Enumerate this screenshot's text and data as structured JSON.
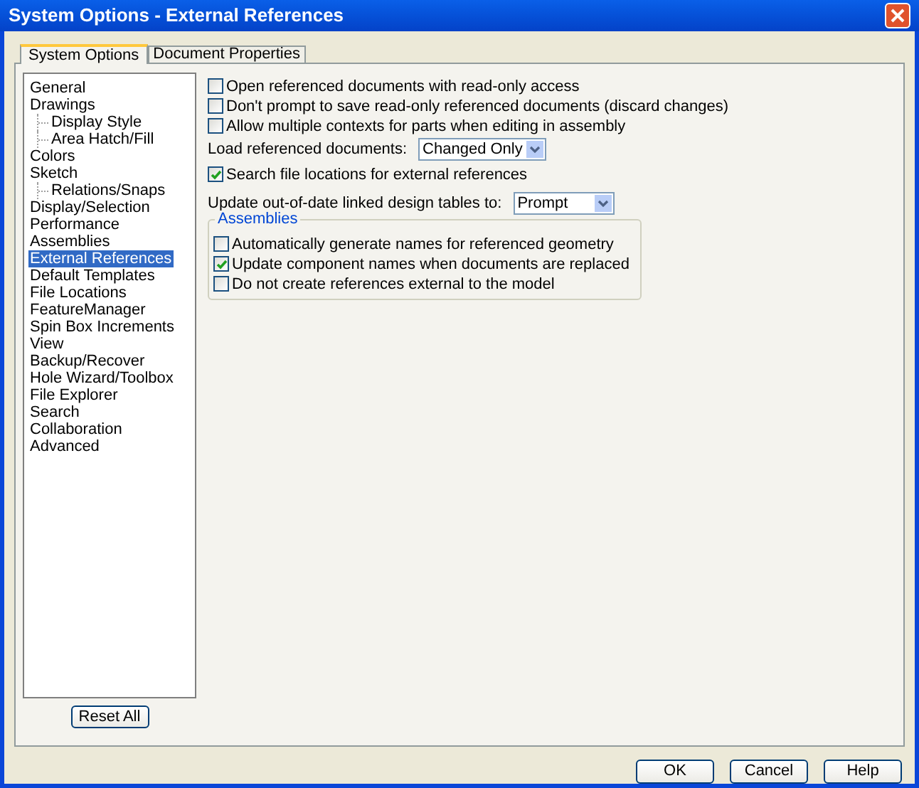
{
  "window": {
    "title": "System Options - External References"
  },
  "tabs": [
    {
      "label": "System Options",
      "selected": true
    },
    {
      "label": "Document Properties",
      "selected": false
    }
  ],
  "tree": [
    {
      "label": "General",
      "selected": false
    },
    {
      "label": "Drawings",
      "selected": false,
      "children": [
        {
          "label": "Display Style",
          "selected": false
        },
        {
          "label": "Area Hatch/Fill",
          "selected": false
        }
      ]
    },
    {
      "label": "Colors",
      "selected": false
    },
    {
      "label": "Sketch",
      "selected": false,
      "children": [
        {
          "label": "Relations/Snaps",
          "selected": false
        }
      ]
    },
    {
      "label": "Display/Selection",
      "selected": false
    },
    {
      "label": "Performance",
      "selected": false
    },
    {
      "label": "Assemblies",
      "selected": false
    },
    {
      "label": "External References",
      "selected": true
    },
    {
      "label": "Default Templates",
      "selected": false
    },
    {
      "label": "File Locations",
      "selected": false
    },
    {
      "label": "FeatureManager",
      "selected": false
    },
    {
      "label": "Spin Box Increments",
      "selected": false
    },
    {
      "label": "View",
      "selected": false
    },
    {
      "label": "Backup/Recover",
      "selected": false
    },
    {
      "label": "Hole Wizard/Toolbox",
      "selected": false
    },
    {
      "label": "File Explorer",
      "selected": false
    },
    {
      "label": "Search",
      "selected": false
    },
    {
      "label": "Collaboration",
      "selected": false
    },
    {
      "label": "Advanced",
      "selected": false
    }
  ],
  "reset_button": "Reset All",
  "options": [
    {
      "kind": "checkbox",
      "label": "Open referenced documents with read-only access",
      "checked": false
    },
    {
      "kind": "checkbox",
      "label": "Don't prompt to save read-only referenced documents (discard changes)",
      "checked": false
    },
    {
      "kind": "checkbox",
      "label": "Allow multiple contexts for parts when editing in assembly",
      "checked": false
    },
    {
      "kind": "dropdown",
      "label": "Load referenced documents:",
      "value": "Changed Only"
    },
    {
      "kind": "checkbox",
      "label": "Search file locations for external references",
      "checked": true
    },
    {
      "kind": "dropdown",
      "label": "Update out-of-date linked design tables to:",
      "value": "Prompt"
    }
  ],
  "assemblies": {
    "title": "Assemblies",
    "options": [
      {
        "label": "Automatically generate names for referenced geometry",
        "checked": false
      },
      {
        "label": "Update component names when documents are replaced",
        "checked": true
      },
      {
        "label": "Do not create references external to the model",
        "checked": false
      }
    ]
  },
  "buttons": [
    "OK",
    "Cancel",
    "Help"
  ]
}
